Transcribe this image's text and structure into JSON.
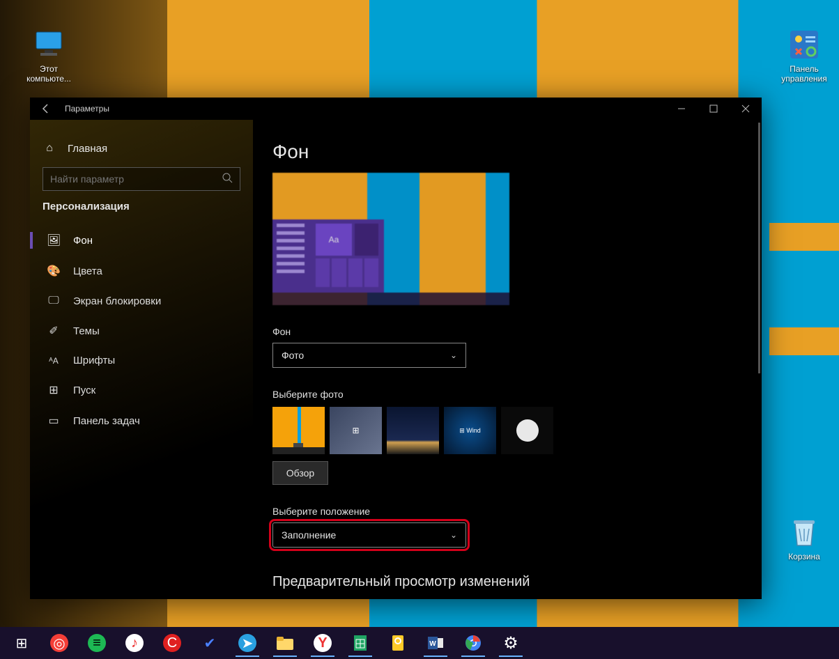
{
  "desktop": {
    "icons": {
      "this_pc": "Этот компьюте...",
      "control_panel": "Панель управления",
      "recycle": "Корзина"
    }
  },
  "window": {
    "title": "Параметры",
    "sidebar": {
      "home": "Главная",
      "search_placeholder": "Найти параметр",
      "category": "Персонализация",
      "items": [
        {
          "icon": "picture-icon",
          "label": "Фон",
          "glyph": "🖼"
        },
        {
          "icon": "palette-icon",
          "label": "Цвета",
          "glyph": "🎨"
        },
        {
          "icon": "lockscreen-icon",
          "label": "Экран блокировки",
          "glyph": "🖵"
        },
        {
          "icon": "themes-icon",
          "label": "Темы",
          "glyph": "✐"
        },
        {
          "icon": "fonts-icon",
          "label": "Шрифты",
          "glyph": "ᴬA"
        },
        {
          "icon": "start-icon",
          "label": "Пуск",
          "glyph": "⊞"
        },
        {
          "icon": "taskbar-icon",
          "label": "Панель задач",
          "glyph": "▭"
        }
      ]
    },
    "content": {
      "title": "Фон",
      "bg_label": "Фон",
      "bg_value": "Фото",
      "choose_photo": "Выберите фото",
      "thumb4_text": "⊞ Wind",
      "browse": "Обзор",
      "position_label": "Выберите положение",
      "position_value": "Заполнение",
      "preview_header": "Предварительный просмотр изменений"
    }
  }
}
